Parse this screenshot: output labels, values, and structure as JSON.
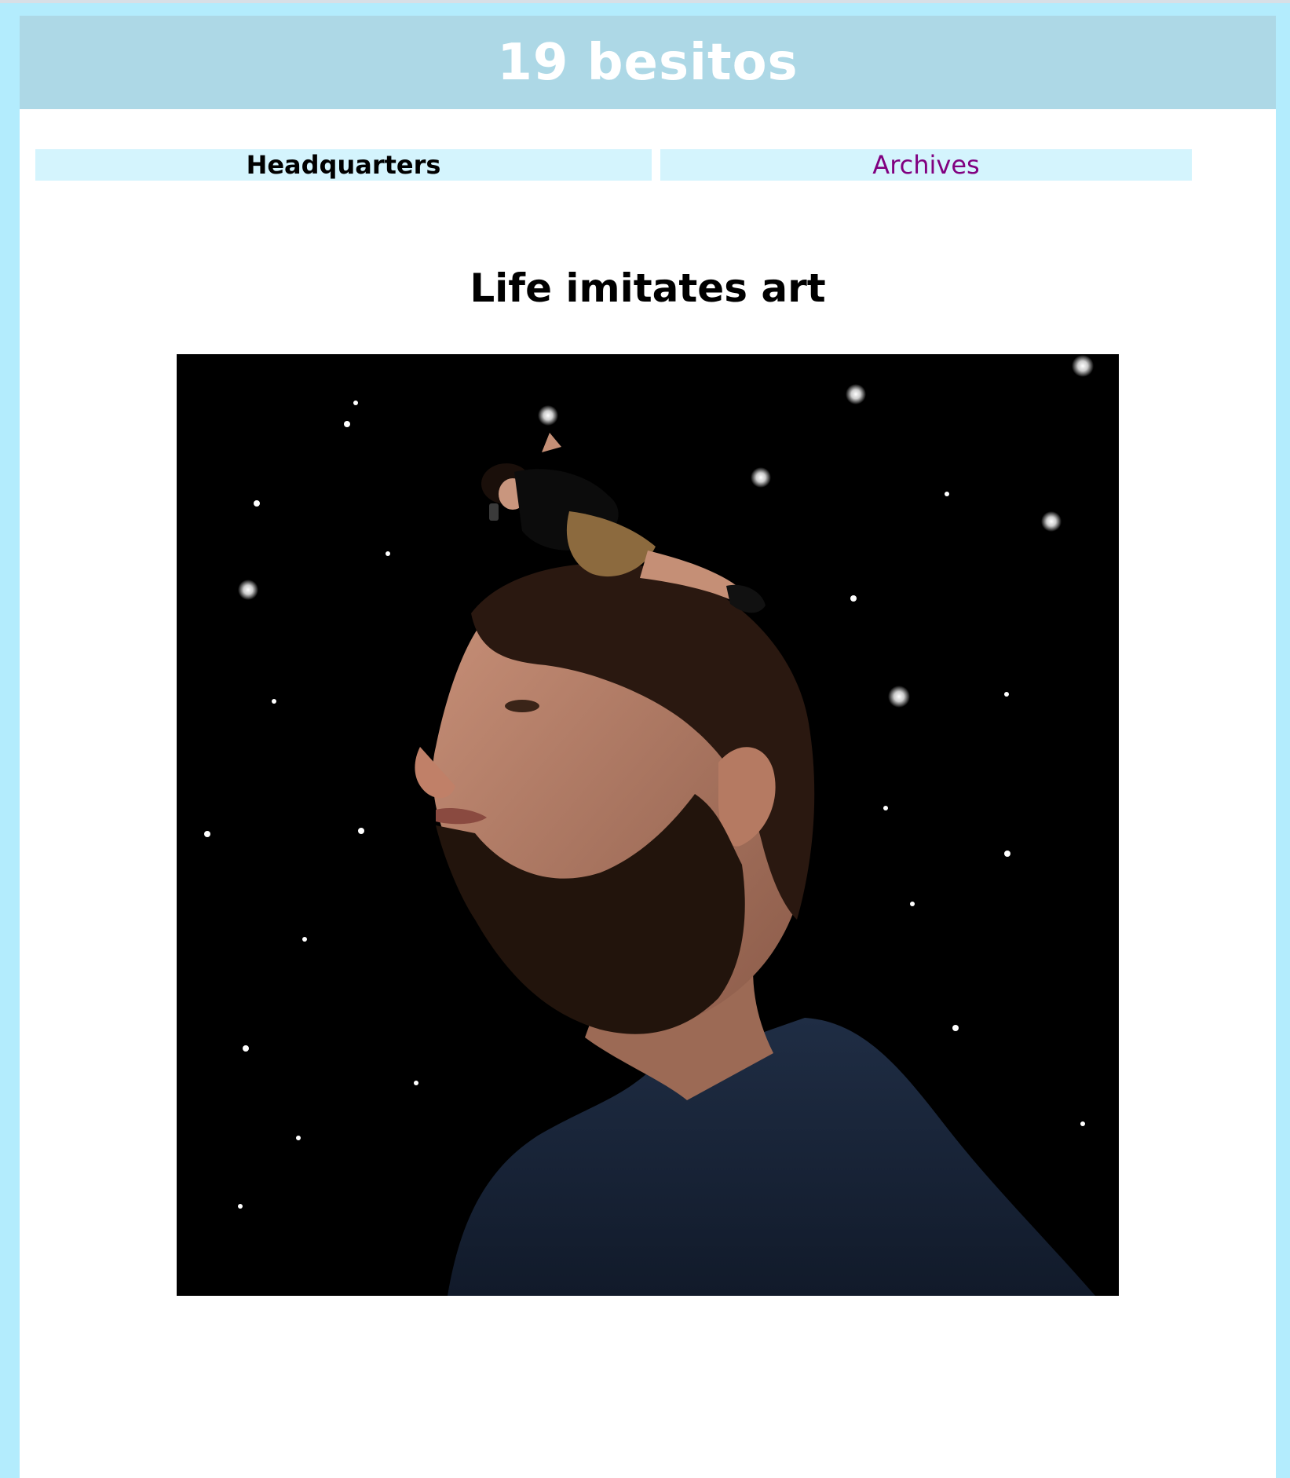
{
  "header": {
    "title": "19 besitos"
  },
  "nav": {
    "items": [
      {
        "label": "Headquarters",
        "active": true
      },
      {
        "label": "Archives",
        "active": false
      }
    ]
  },
  "post": {
    "title": "Life imitates art"
  },
  "colors": {
    "page_background": "#b3ecfd",
    "header_background": "#add8e6",
    "nav_background": "#d4f4fd",
    "visited_link": "#800080"
  }
}
